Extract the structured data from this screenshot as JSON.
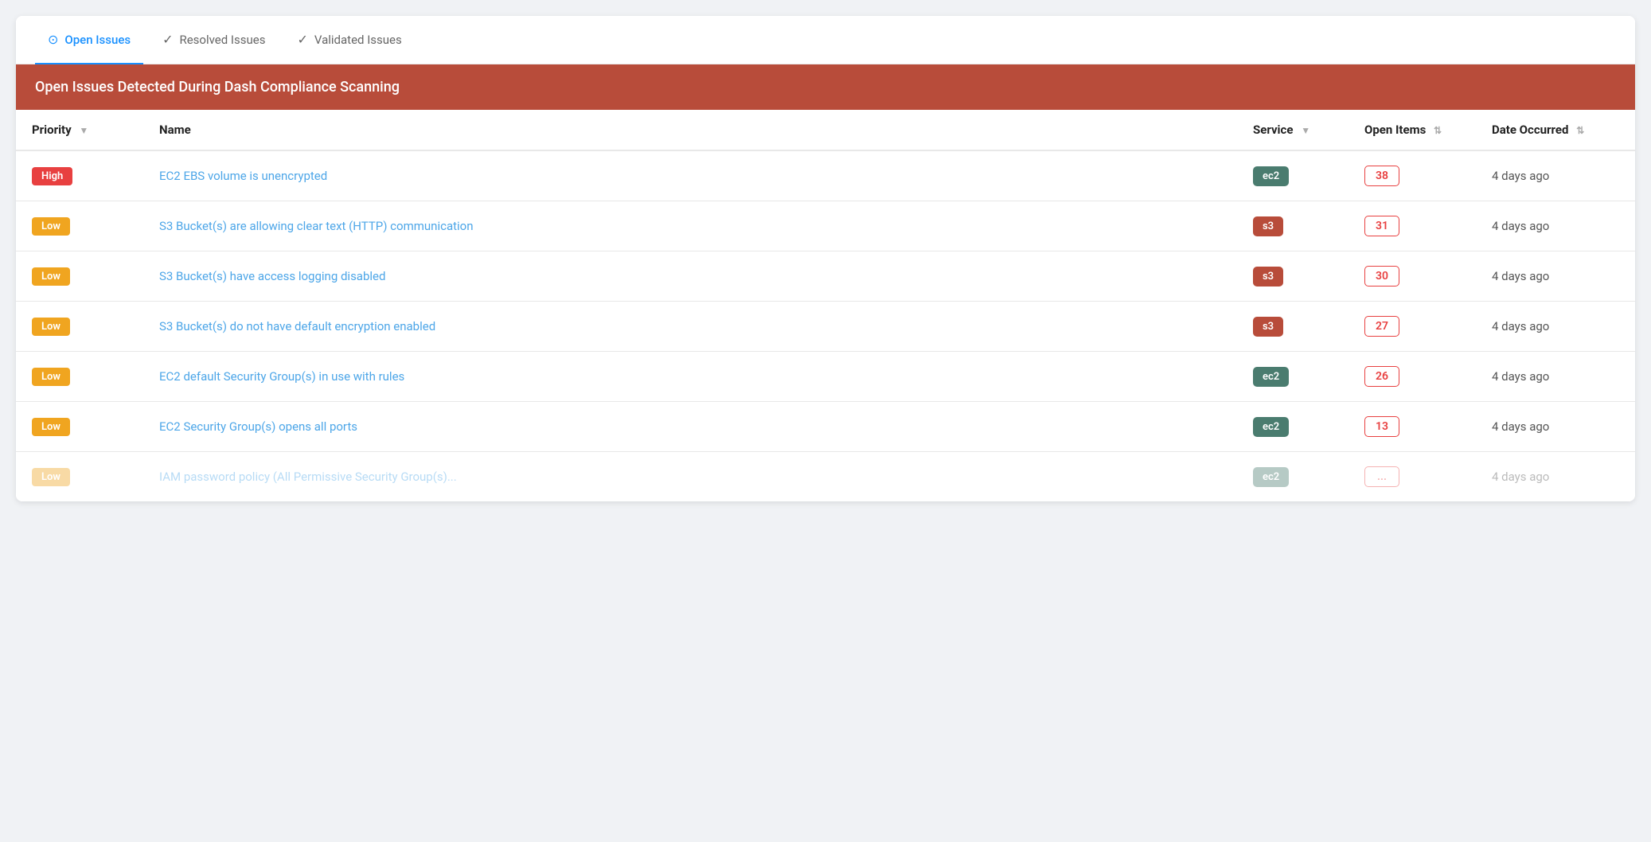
{
  "tabs": [
    {
      "id": "open",
      "label": "Open Issues",
      "icon": "⊙",
      "active": true
    },
    {
      "id": "resolved",
      "label": "Resolved Issues",
      "icon": "⊙",
      "active": false
    },
    {
      "id": "validated",
      "label": "Validated Issues",
      "icon": "⊙",
      "active": false
    }
  ],
  "banner": {
    "text": "Open Issues Detected During Dash Compliance Scanning"
  },
  "table": {
    "columns": [
      {
        "key": "priority",
        "label": "Priority",
        "sortable": true
      },
      {
        "key": "name",
        "label": "Name",
        "sortable": false
      },
      {
        "key": "service",
        "label": "Service",
        "sortable": true
      },
      {
        "key": "open_items",
        "label": "Open Items",
        "sortable": true
      },
      {
        "key": "date_occurred",
        "label": "Date Occurred",
        "sortable": true
      }
    ],
    "rows": [
      {
        "priority": "High",
        "priority_level": "high",
        "name": "EC2 EBS volume is unencrypted",
        "service": "ec2",
        "service_type": "ec2",
        "open_items": "38",
        "date": "4 days ago"
      },
      {
        "priority": "Low",
        "priority_level": "low",
        "name": "S3 Bucket(s) are allowing clear text (HTTP) communication",
        "service": "s3",
        "service_type": "s3",
        "open_items": "31",
        "date": "4 days ago"
      },
      {
        "priority": "Low",
        "priority_level": "low",
        "name": "S3 Bucket(s) have access logging disabled",
        "service": "s3",
        "service_type": "s3",
        "open_items": "30",
        "date": "4 days ago"
      },
      {
        "priority": "Low",
        "priority_level": "low",
        "name": "S3 Bucket(s) do not have default encryption enabled",
        "service": "s3",
        "service_type": "s3",
        "open_items": "27",
        "date": "4 days ago"
      },
      {
        "priority": "Low",
        "priority_level": "low",
        "name": "EC2 default Security Group(s) in use with rules",
        "service": "ec2",
        "service_type": "ec2",
        "open_items": "26",
        "date": "4 days ago"
      },
      {
        "priority": "Low",
        "priority_level": "low",
        "name": "EC2 Security Group(s) opens all ports",
        "service": "ec2",
        "service_type": "ec2",
        "open_items": "13",
        "date": "4 days ago"
      },
      {
        "priority": "Low",
        "priority_level": "low",
        "name": "...",
        "service": "ec2",
        "service_type": "ec2",
        "open_items": "...",
        "date": "4 days ago",
        "partial": true
      }
    ]
  }
}
